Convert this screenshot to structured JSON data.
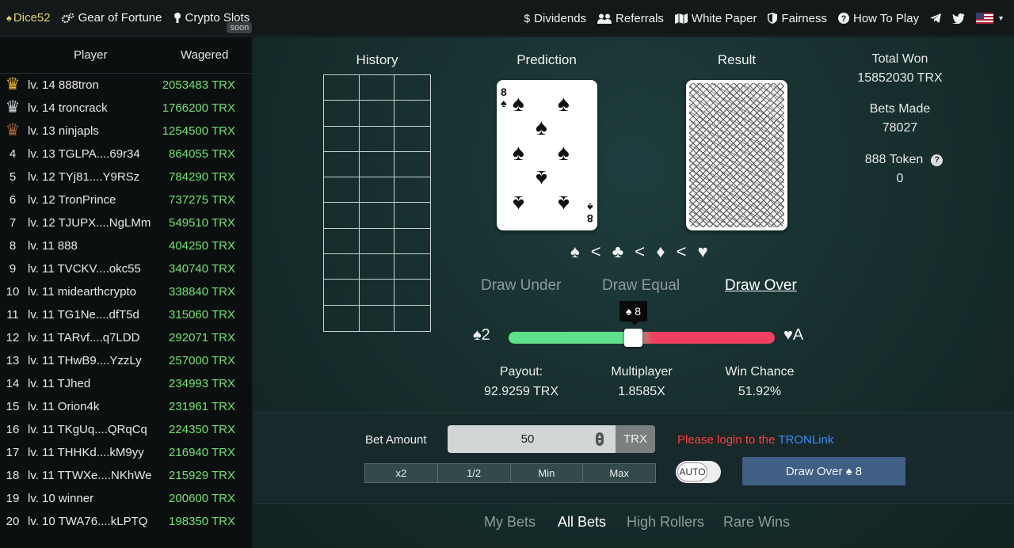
{
  "nav": {
    "brand": "Dice52",
    "links_left": [
      {
        "label": "Gear of Fortune",
        "icon": "gears-icon"
      },
      {
        "label": "Crypto Slots",
        "icon": "lightbulb-icon",
        "badge": "soon"
      }
    ],
    "links_right": [
      {
        "label": "Dividends",
        "icon": "dollar-icon"
      },
      {
        "label": "Referrals",
        "icon": "users-icon"
      },
      {
        "label": "White Paper",
        "icon": "map-icon"
      },
      {
        "label": "Fairness",
        "icon": "shield-icon"
      },
      {
        "label": "How To Play",
        "icon": "question-icon"
      }
    ],
    "language": "us-flag"
  },
  "leaderboard": {
    "headers": {
      "player": "Player",
      "wagered": "Wagered"
    },
    "rows": [
      {
        "rank": "1",
        "crown": "gold",
        "name": "lv. 14 888tron",
        "amount": "2053483 TRX"
      },
      {
        "rank": "2",
        "crown": "silver",
        "name": "lv. 14 troncrack",
        "amount": "1766200 TRX"
      },
      {
        "rank": "3",
        "crown": "bronze",
        "name": "lv. 13 ninjapls",
        "amount": "1254500 TRX"
      },
      {
        "rank": "4",
        "name": "lv. 13 TGLPA....69r34",
        "amount": "864055 TRX"
      },
      {
        "rank": "5",
        "name": "lv. 12 TYj81....Y9RSz",
        "amount": "784290 TRX"
      },
      {
        "rank": "6",
        "name": "lv. 12 TronPrince",
        "amount": "737275 TRX"
      },
      {
        "rank": "7",
        "name": "lv. 12 TJUPX....NgLMm",
        "amount": "549510 TRX"
      },
      {
        "rank": "8",
        "name": "lv. 11 888",
        "amount": "404250 TRX"
      },
      {
        "rank": "9",
        "name": "lv. 11 TVCKV....okc55",
        "amount": "340740 TRX"
      },
      {
        "rank": "10",
        "name": "lv. 11 midearthcrypto",
        "amount": "338840 TRX"
      },
      {
        "rank": "11",
        "name": "lv. 11 TG1Ne....dfT5d",
        "amount": "315060 TRX"
      },
      {
        "rank": "12",
        "name": "lv. 11 TARvf....q7LDD",
        "amount": "292071 TRX"
      },
      {
        "rank": "13",
        "name": "lv. 11 THwB9....YzzLy",
        "amount": "257000 TRX"
      },
      {
        "rank": "14",
        "name": "lv. 11 TJhed",
        "amount": "234993 TRX"
      },
      {
        "rank": "15",
        "name": "lv. 11 Orion4k",
        "amount": "231961 TRX"
      },
      {
        "rank": "16",
        "name": "lv. 11 TKgUq....QRqCq",
        "amount": "224350 TRX"
      },
      {
        "rank": "17",
        "name": "lv. 11 THHKd....kM9yy",
        "amount": "216940 TRX"
      },
      {
        "rank": "18",
        "name": "lv. 11 TTWXe....NKhWe",
        "amount": "215929 TRX"
      },
      {
        "rank": "19",
        "name": "lv. 10 winner",
        "amount": "200600 TRX"
      },
      {
        "rank": "20",
        "name": "lv. 10 TWA76....kLPTQ",
        "amount": "198350 TRX"
      }
    ]
  },
  "game": {
    "history_title": "History",
    "prediction_title": "Prediction",
    "result_title": "Result",
    "prediction_card": {
      "rank": "8",
      "suit": "♠"
    },
    "suit_order": "♠ < ♣ < ♦ < ♥",
    "draw_options": [
      {
        "label": "Draw Under",
        "active": false
      },
      {
        "label": "Draw Equal",
        "active": false
      },
      {
        "label": "Draw Over",
        "active": true
      }
    ],
    "slider": {
      "min_label": "♠2",
      "max_label": "♥A",
      "tooltip": "♠ 8"
    },
    "payout_label": "Payout:",
    "payout_value": "92.9259 TRX",
    "multiplier_label": "Multiplayer",
    "multiplier_value": "1.8585X",
    "win_chance_label": "Win Chance",
    "win_chance_value": "51.92%"
  },
  "stats": {
    "total_won_label": "Total Won",
    "total_won_value": "15852030 TRX",
    "bets_made_label": "Bets Made",
    "bets_made_value": "78027",
    "token_label": "888 Token",
    "token_value": "0"
  },
  "bet": {
    "label": "Bet Amount",
    "amount": "50",
    "unit": "TRX",
    "quick": [
      "x2",
      "1/2",
      "Min",
      "Max"
    ],
    "login_prefix": "Please login to the ",
    "login_link": "TRONLink",
    "auto_label": "AUTO",
    "draw_button": "Draw Over ♠ 8"
  },
  "tabs": [
    "My Bets",
    "All Bets",
    "High Rollers",
    "Rare Wins"
  ],
  "colors": {
    "brand": "#e6d26b",
    "wager_green": "#6fe36f",
    "slider_low": "#5fe08a",
    "slider_high": "#ef4060",
    "draw_button": "#3f5f85",
    "error": "#ff3b3b",
    "link": "#3b8cff"
  }
}
